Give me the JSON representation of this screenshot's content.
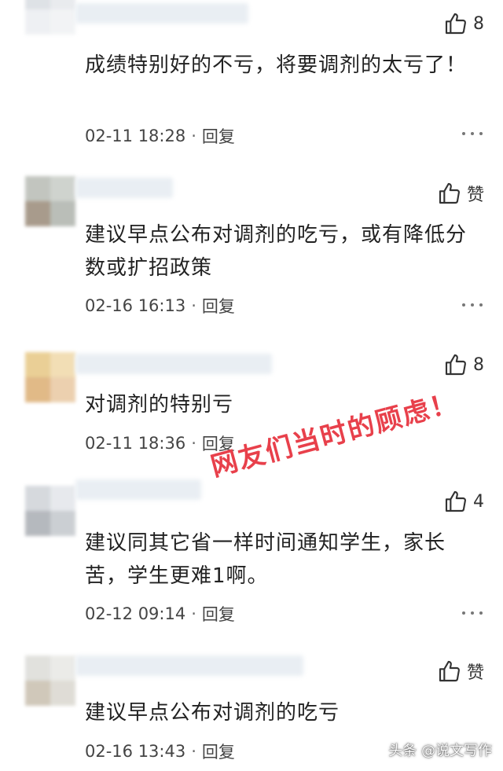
{
  "comments": [
    {
      "likes": "8",
      "text": "成绩特别好的不亏，将要调剂的太亏了！",
      "time": "02-11 18:28",
      "reply": "回复"
    },
    {
      "likes": "赞",
      "text": "建议早点公布对调剂的吃亏，或有降低分数或扩招政策",
      "time": "02-16 16:13",
      "reply": "回复"
    },
    {
      "likes": "8",
      "text": "对调剂的特别亏",
      "time": "02-11 18:36",
      "reply": "回复"
    },
    {
      "likes": "4",
      "text": "建议同其它省一样时间通知学生，家长苦，学生更难1啊。",
      "time": "02-12 09:14",
      "reply": "回复"
    },
    {
      "likes": "赞",
      "text": "建议早点公布对调剂的吃亏",
      "time": "02-16 13:43",
      "reply": "回复"
    }
  ],
  "stamp_text": "网友们当时的顾虑！",
  "watermark": "头条 @说文写作",
  "separator": "·",
  "colors": {
    "stamp": "#e8404b",
    "text": "#222222",
    "meta": "#444444"
  },
  "icons": {
    "like": "thumbs-up-icon",
    "more": "more-dots-icon"
  }
}
